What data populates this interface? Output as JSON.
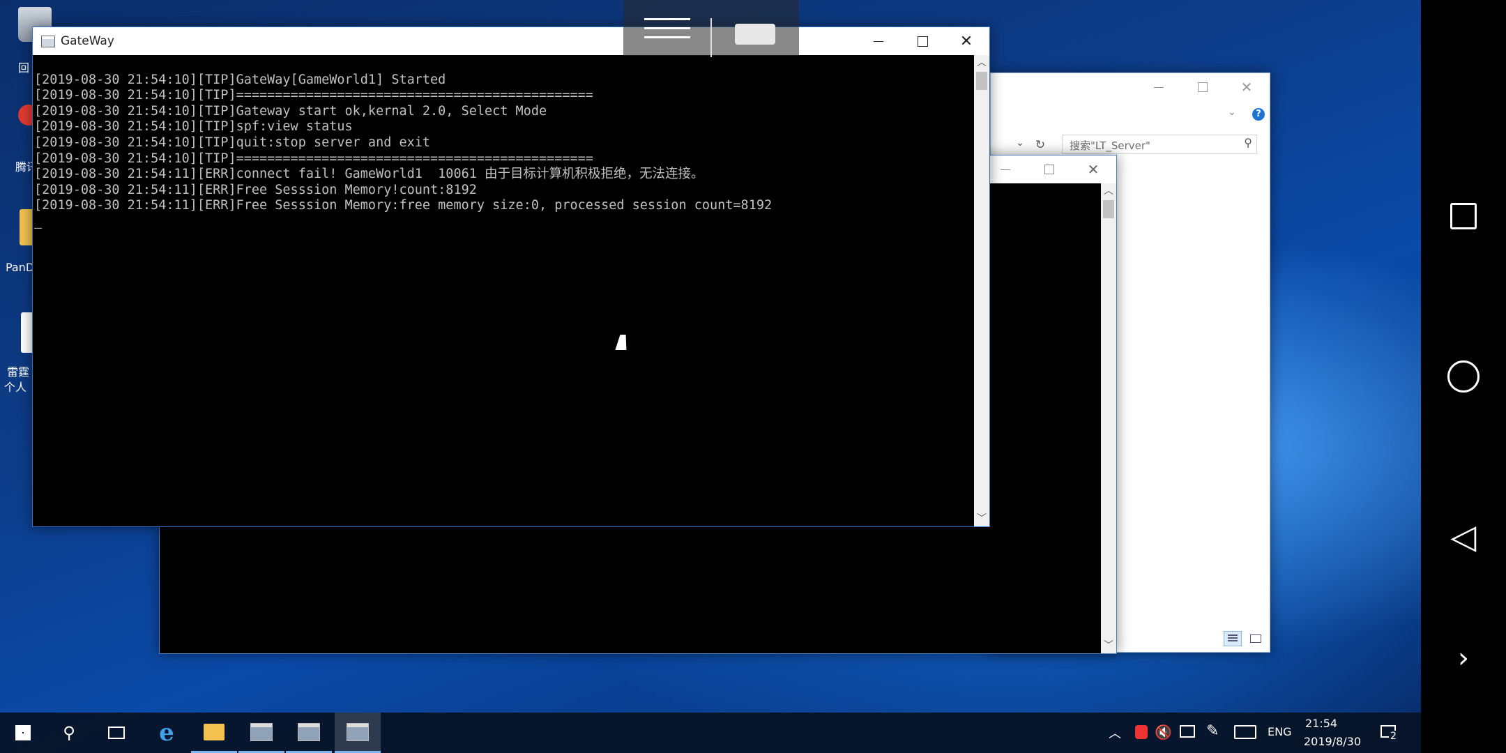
{
  "desktop": {
    "icons": [
      {
        "label": "回"
      },
      {
        "label": "腾讯"
      },
      {
        "label": "PanD"
      },
      {
        "label": "雷霆"
      },
      {
        "label": "个人"
      }
    ]
  },
  "main_window": {
    "title": "GateWay",
    "console_lines": [
      "[2019-08-30 21:54:10][TIP]GateWay[GameWorld1] Started",
      "[2019-08-30 21:54:10][TIP]==============================================",
      "[2019-08-30 21:54:10][TIP]Gateway start ok,kernal 2.0, Select Mode",
      "[2019-08-30 21:54:10][TIP]spf:view status",
      "[2019-08-30 21:54:10][TIP]quit:stop server and exit",
      "[2019-08-30 21:54:10][TIP]==============================================",
      "[2019-08-30 21:54:11][ERR]connect fail! GameWorld1  10061 由于目标计算机积极拒绝，无法连接。",
      "[2019-08-30 21:54:11][ERR]Free Sesssion Memory!count:8192",
      "[2019-08-30 21:54:11][ERR]Free Sesssion Memory:free memory size:0, processed session count=8192",
      "_"
    ]
  },
  "explorer_window": {
    "search_placeholder": "搜索\"LT_Server\""
  },
  "taskbar": {
    "language": "ENG",
    "time": "21:54",
    "date": "2019/8/30",
    "notification_count": "2"
  },
  "colors": {
    "accent": "#2b6fc7",
    "console_bg": "#000000",
    "console_text": "#c0c0c0"
  }
}
